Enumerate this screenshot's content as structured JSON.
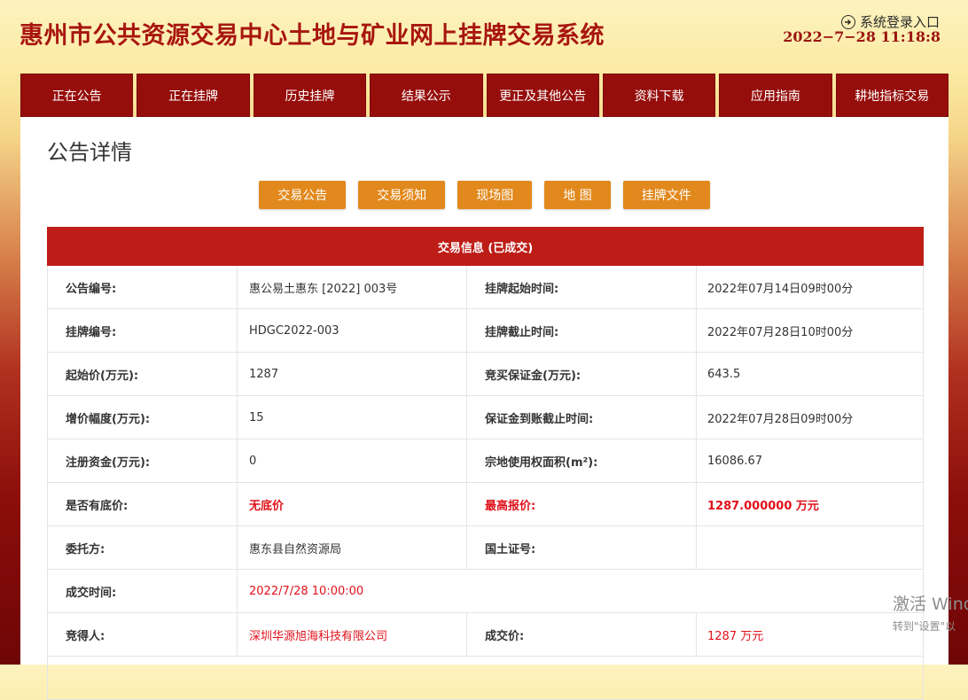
{
  "header": {
    "title": "惠州市公共资源交易中心土地与矿业网上挂牌交易系统",
    "login_label": "系统登录入口",
    "login_icon": "login-icon",
    "datetime": "2022−7−28 11:18:8"
  },
  "nav": {
    "items": [
      "正在公告",
      "正在挂牌",
      "历史挂牌",
      "结果公示",
      "更正及其他公告",
      "资料下载",
      "应用指南",
      "耕地指标交易"
    ]
  },
  "page": {
    "title": "公告详情"
  },
  "tabs": [
    "交易公告",
    "交易须知",
    "现场图",
    "地 图",
    "挂牌文件"
  ],
  "table": {
    "header": "交易信息 (已成交)",
    "rows": [
      {
        "l1": "公告编号:",
        "v1": "惠公易土惠东 [2022] 003号",
        "l2": "挂牌起始时间:",
        "v2": "2022年07月14日09时00分"
      },
      {
        "l1": "挂牌编号:",
        "v1": "HDGC2022-003",
        "l2": "挂牌截止时间:",
        "v2": "2022年07月28日10时00分"
      },
      {
        "l1": "起始价(万元):",
        "v1": "1287",
        "l2": "竞买保证金(万元):",
        "v2": "643.5"
      },
      {
        "l1": "增价幅度(万元):",
        "v1": "15",
        "l2": "保证金到账截止时间:",
        "v2": "2022年07月28日09时00分"
      },
      {
        "l1": "注册资金(万元):",
        "v1": "0",
        "l2": "宗地使用权面积(m²):",
        "v2": "16086.67"
      },
      {
        "l1": "是否有底价:",
        "v1": "无底价",
        "l2": "最高报价:",
        "v2": "1287.000000 万元"
      },
      {
        "l1": "委托方:",
        "v1": "惠东县自然资源局",
        "l2": "国土证号:",
        "v2": ""
      },
      {
        "l1": "成交时间:",
        "v1": "2022/7/28 10:00:00"
      },
      {
        "l1": "竞得人:",
        "v1": "深圳华源旭海科技有限公司",
        "l2": "成交价:",
        "v2": "1287 万元"
      }
    ]
  },
  "watermark": {
    "line1": "激活 Wind",
    "line2": "转到\"设置\"以"
  },
  "colors": {
    "brand_red": "#a8160f",
    "nav_bg": "#960e0c",
    "table_header": "#be1d17",
    "button_orange": "#e2891d",
    "highlight_red": "#e0111a"
  }
}
